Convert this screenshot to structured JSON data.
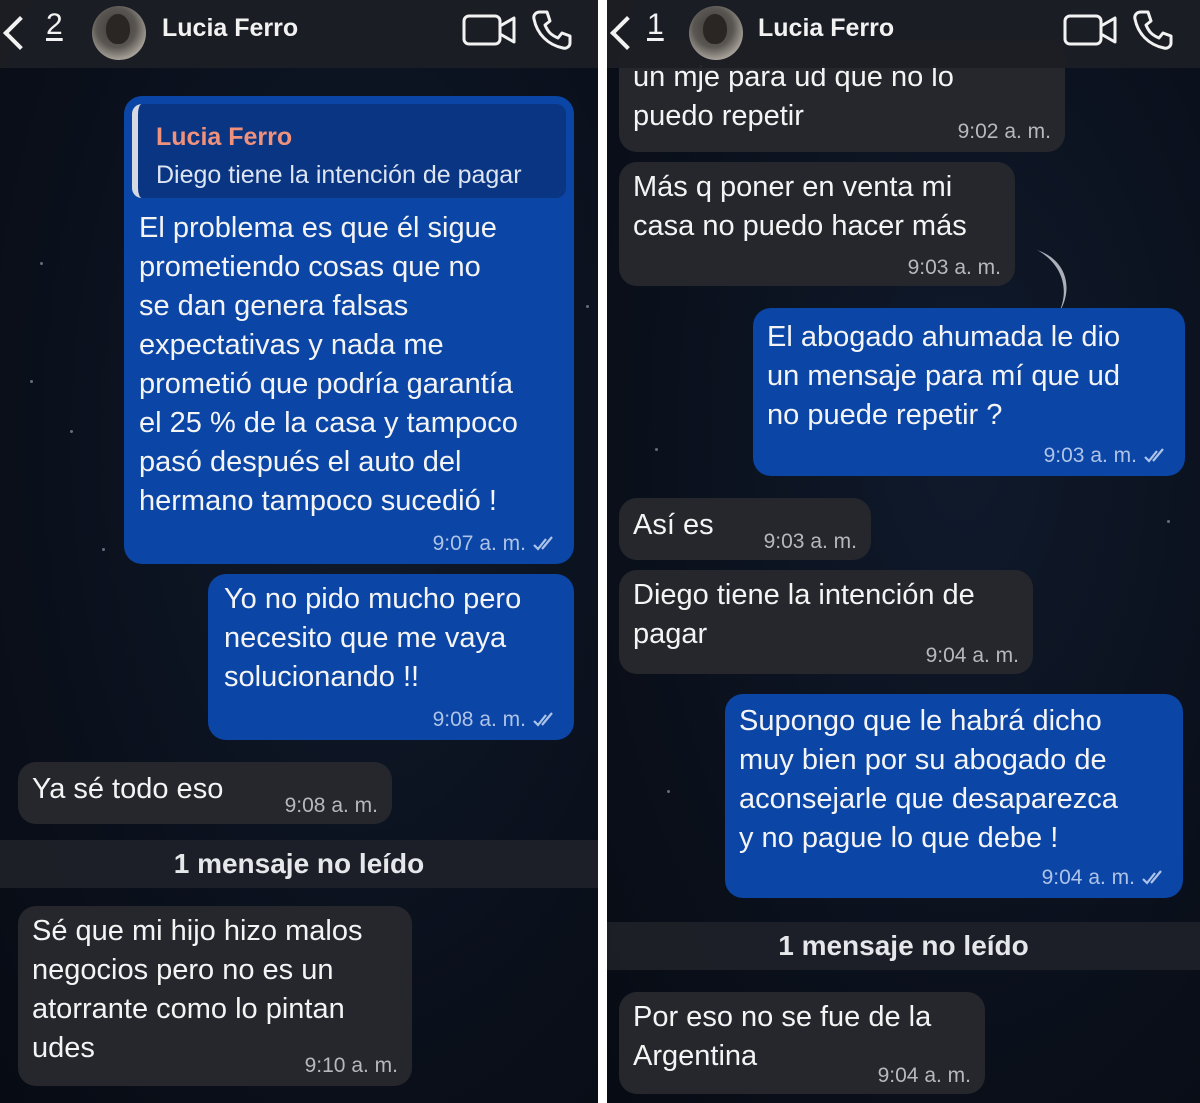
{
  "left": {
    "header": {
      "unread_count": "2",
      "contact_name": "Lucia Ferro"
    },
    "quote": {
      "author": "Lucia Ferro",
      "text": "Diego tiene la intención de pagar"
    },
    "messages": [
      {
        "direction": "out",
        "text": "El problema es que él sigue\nprometiendo cosas que no\nse dan genera falsas\nexpectativas y nada me\nprometió que podría garantía\nel 25 % de la casa y tampoco\npasó después el auto del\nhermano tampoco sucedió !",
        "time": "9:07 a. m.",
        "status": "read"
      },
      {
        "direction": "out",
        "text": "Yo no pido mucho pero\nnecesito que me vaya\nsolucionando !!",
        "time": "9:08 a. m.",
        "status": "read"
      },
      {
        "direction": "in",
        "text": "Ya sé todo eso",
        "time": "9:08 a. m."
      },
      {
        "direction": "in",
        "text": "Sé que mi hijo hizo malos\nnegocios pero no es un\natorrante como lo pintan\nudes",
        "time": "9:10 a. m."
      }
    ],
    "unread_label": "1 mensaje no leído"
  },
  "right": {
    "header": {
      "unread_count": "1",
      "contact_name": "Lucia Ferro"
    },
    "messages": [
      {
        "direction": "in",
        "text": "un mje para ud que no lo\npuedo repetir",
        "time": "9:02 a. m."
      },
      {
        "direction": "in",
        "text": "Más q poner en venta mi\ncasa no puedo hacer más",
        "time": "9:03 a. m."
      },
      {
        "direction": "out",
        "text": "El abogado ahumada le dio\nun mensaje para mí que ud\nno puede repetir ?",
        "time": "9:03 a. m.",
        "status": "read"
      },
      {
        "direction": "in",
        "text": "Así es",
        "time": "9:03 a. m."
      },
      {
        "direction": "in",
        "text": "Diego tiene la intención de\npagar",
        "time": "9:04 a. m."
      },
      {
        "direction": "out",
        "text": "Supongo que le habrá dicho\nmuy bien por su abogado de\naconsejarle que desaparezca\ny no pague lo que debe !",
        "time": "9:04 a. m.",
        "status": "read"
      },
      {
        "direction": "in",
        "text": "Por eso no se fue de la\nArgentina",
        "time": "9:04 a. m."
      }
    ],
    "unread_label": "1 mensaje no leído"
  },
  "colors": {
    "incoming_bubble": "#25272c",
    "outgoing_bubble": "#0b46a6",
    "quote_author": "#f0917c",
    "background": "#0b111d"
  },
  "icons": [
    "back-chevron-icon",
    "video-call-icon",
    "phone-call-icon",
    "double-check-icon"
  ]
}
